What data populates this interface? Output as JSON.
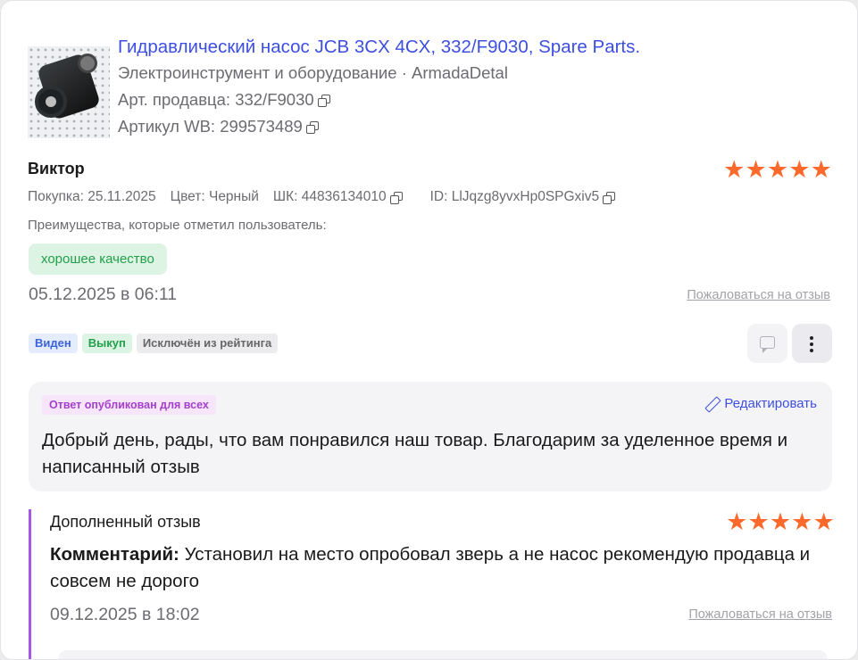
{
  "product": {
    "title": "Гидравлический насос JCB 3CX 4CX, 332/F9030, Spare Parts.",
    "category": "Электроинструмент и оборудование · ArmadaDetal",
    "seller_article": "Арт. продавца: 332/F9030",
    "wb_article": "Артикул WB: 299573489",
    "image_icon": "hydraulic-pump-photo"
  },
  "review": {
    "author": "Виктор",
    "rating": 5,
    "purchase": "Покупка: 25.11.2025",
    "color": "Цвет: Черный",
    "barcode": "ШК: 44836134010",
    "id": "ID: LlJqzg8yvxHp0SPGxiv5",
    "advantages_label": "Преимущества, которые отметил пользователь:",
    "advantage_tag": "хорошее качество",
    "date": "05.12.2025 в 06:11",
    "complain_label": "Пожаловаться на отзыв",
    "badges": [
      "Виден",
      "Выкуп",
      "Исключён из рейтинга"
    ],
    "star_color": "#ff6a2c"
  },
  "answer": {
    "published_badge": "Ответ опубликован для всех",
    "edit_label": "Редактировать",
    "text": "Добрый день, рады, что вам понравился наш товар. Благодарим за уделенное время и написанный отзыв"
  },
  "supplement": {
    "title": "Дополненный отзыв",
    "rating": 5,
    "comment_label": "Комментарий:",
    "comment_text": " Установил на место опробовал зверь а не насос рекомендую продавца и совсем не дорого",
    "date": "09.12.2025 в 18:02",
    "complain_label": "Пожаловаться на отзыв"
  }
}
